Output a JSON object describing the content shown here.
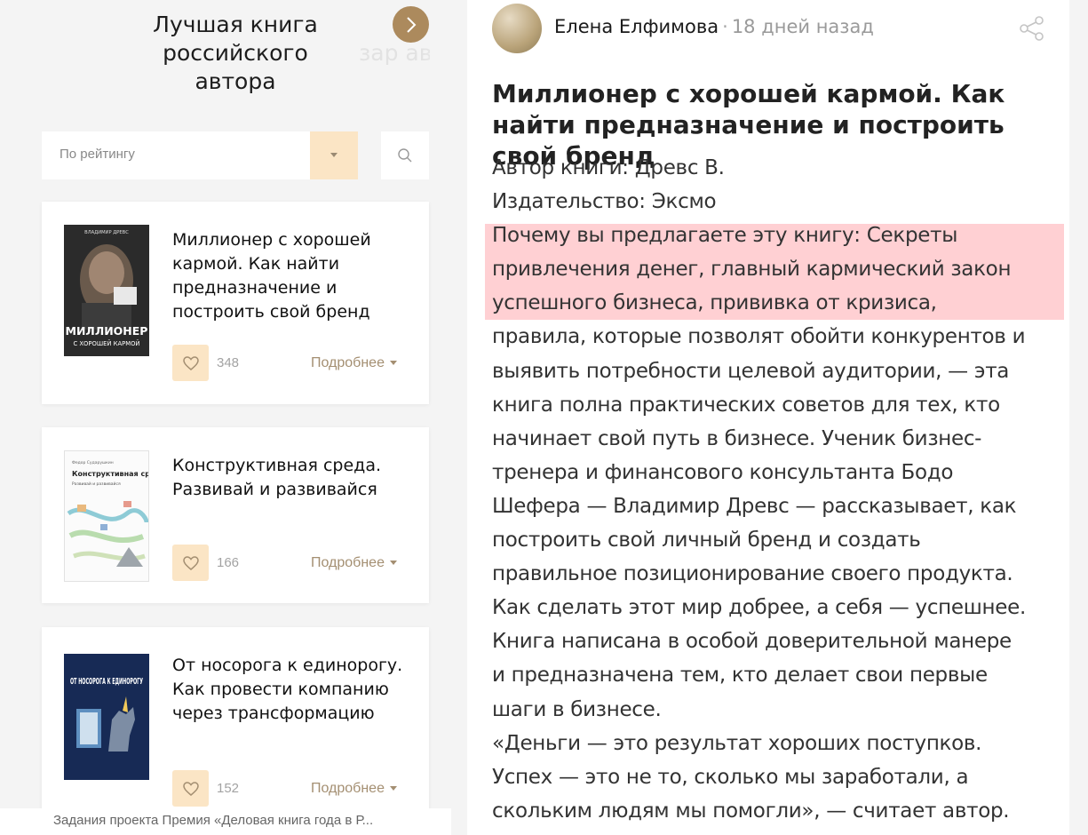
{
  "category": {
    "title": "Лучшая книга российского автора",
    "next_title": "зар автор"
  },
  "filter": {
    "sort_placeholder": "По рейтингу"
  },
  "books": [
    {
      "title": "Миллионер с хорошей кармой. Как найти предназначение и построить свой бренд",
      "likes": "348",
      "more": "Подробнее",
      "cover": {
        "author": "ВЛАДИМИР ДРЕВС",
        "title": "МИЛЛИОНЕР",
        "subtitle": "С ХОРОШЕЙ КАРМОЙ",
        "badge": "КАК НАЙТИ ПРЕДНАЗНАЧЕНИЕ И ПОСТРОИТЬ СВОЙ БРЕНД"
      }
    },
    {
      "title": "Конструктивная среда. Развивай и развивайся",
      "likes": "166",
      "more": "Подробнее",
      "cover": {
        "author": "Федор Сударушкин",
        "title": "Конструктивная среда.",
        "subtitle": "Развивай и развивайся"
      }
    },
    {
      "title": "От носорога к единорогу. Как провести компанию через трансформацию",
      "likes": "152",
      "more": "Подробнее",
      "cover": {
        "title": "ОТ НОСОРОГА К ЕДИНОРОГУ"
      }
    }
  ],
  "footer": {
    "text": "Задания проекта Премия «Деловая книга года в Р..."
  },
  "post": {
    "author": "Елена Елфимова",
    "separator": "·",
    "time": "18 дней назад",
    "title": "Миллионер с хорошей кармой. Как найти предназначение и построить свой бренд",
    "lines": [
      "Автор книги: Древс В.",
      "Издательство: Эксмо",
      "Почему вы предлагаете эту книгу: Секреты",
      "привлечения денег, главный кармический закон",
      "успешного бизнеса, прививка от кризиса,",
      "правила, которые позволят обойти конкурентов и",
      "выявить потребности целевой аудитории, — эта",
      "книга полна практических советов для тех, кто",
      "начинает свой путь в бизнесе. Ученик бизнес-",
      "тренера и финансового консультанта Бодо",
      "Шефера — Владимир Древс — рассказывает, как",
      "построить свой личный бренд и создать",
      "правильное позиционирование своего продукта.",
      "Как сделать этот мир добрее, а себя — успешнее.",
      "Книга написана в особой доверительной манере",
      "и предназначена тем, кто делает свои первые",
      "шаги в бизнесе.",
      "«Деньги — это результат хороших поступков.",
      "Успех — это не то, сколько мы заработали, а",
      "скольким людям мы помогли», — считает автор."
    ]
  },
  "colors": {
    "accent": "#ac8a5d",
    "like_bg": "#fbe5c5",
    "highlight": "#ffd0d3"
  },
  "icons": [
    "chevron-right-icon",
    "dropdown-triangle-icon",
    "search-icon",
    "heart-icon",
    "share-icon"
  ]
}
